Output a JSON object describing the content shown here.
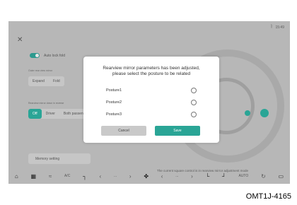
{
  "status": {
    "time": "15:49",
    "icon": "bluetooth-icon"
  },
  "background": {
    "auto_fold_label": "Auto lock fold",
    "mirror_mode_caption": "Outer rear view mirror",
    "mirror_mode_options": [
      "Expand",
      "Fold"
    ],
    "reverse_caption": "Rearview mirror down in reverse",
    "reverse_options": [
      "Off",
      "Driver",
      "Both passenger"
    ],
    "memory_setting": "Memory setting",
    "hint": "The current square control is in rearview mirror adjustment mode"
  },
  "dialog": {
    "title_line1": "Rearview mirror parameters has been adjusted,",
    "title_line2": "please select the posture to be related",
    "options": [
      "Posture1",
      "Posture2",
      "Posture3"
    ],
    "cancel_label": "Cancel",
    "save_label": "Save"
  },
  "bottom_bar": {
    "ac_label": "A/C",
    "auto_label": "AUTO",
    "left_temp": "...",
    "right_temp": "..."
  },
  "figure_code": "OMT1J-4165",
  "colors": {
    "accent": "#2aa596",
    "dim": "#b7b7b7"
  }
}
